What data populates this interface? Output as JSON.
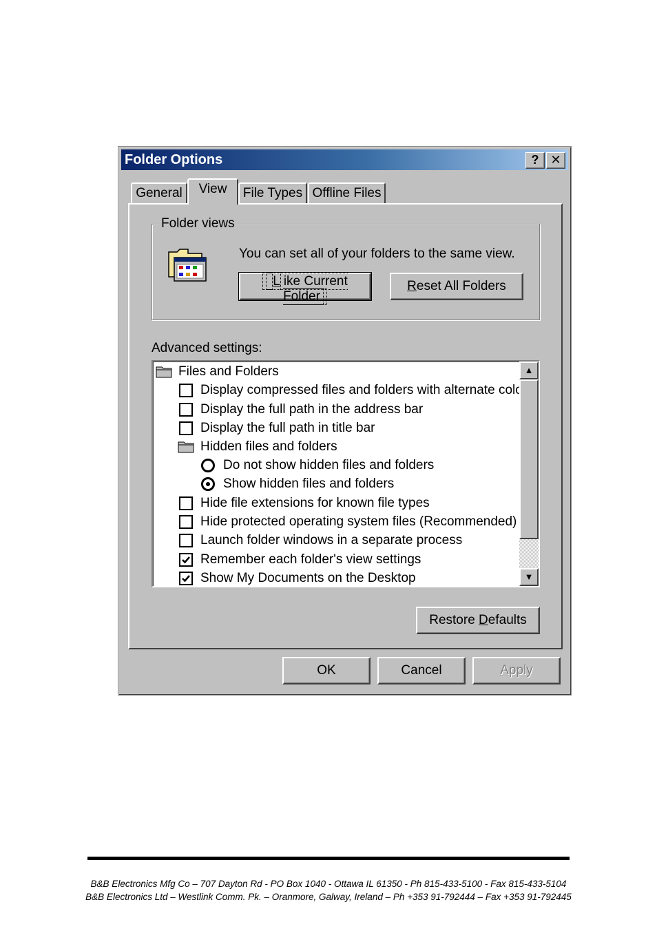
{
  "dialog": {
    "title": "Folder Options",
    "help_glyph": "?",
    "close_glyph": "✕",
    "tabs": [
      {
        "label": "General"
      },
      {
        "label": "View"
      },
      {
        "label": "File Types"
      },
      {
        "label": "Offline Files"
      }
    ],
    "active_tab": "View",
    "folder_views": {
      "label": "Folder views",
      "description": "You can set all of your folders to the same view.",
      "like_current_pre": "",
      "like_current_accel": "L",
      "like_current_post": "ike Current Folder",
      "reset_pre": "",
      "reset_accel": "R",
      "reset_post": "eset All Folders"
    },
    "advanced": {
      "label": "Advanced settings:",
      "items": [
        {
          "type": "folder",
          "label": "Files and Folders"
        },
        {
          "type": "checkbox",
          "checked": false,
          "label": "Display compressed files and folders with alternate color"
        },
        {
          "type": "checkbox",
          "checked": false,
          "label": "Display the full path in the address bar"
        },
        {
          "type": "checkbox",
          "checked": false,
          "label": "Display the full path in title bar"
        },
        {
          "type": "folder",
          "label": "Hidden files and folders"
        },
        {
          "type": "radio",
          "checked": false,
          "label": "Do not show hidden files and folders"
        },
        {
          "type": "radio",
          "checked": true,
          "label": "Show hidden files and folders"
        },
        {
          "type": "checkbox",
          "checked": false,
          "label": "Hide file extensions for known file types"
        },
        {
          "type": "checkbox",
          "checked": false,
          "label": "Hide protected operating system files (Recommended)"
        },
        {
          "type": "checkbox",
          "checked": false,
          "label": "Launch folder windows in a separate process"
        },
        {
          "type": "checkbox",
          "checked": true,
          "label": "Remember each folder's view settings"
        },
        {
          "type": "checkbox",
          "checked": true,
          "label": "Show My Documents on the Desktop"
        }
      ],
      "scroll_up_glyph": "▲",
      "scroll_down_glyph": "▼"
    },
    "restore_pre": "Restore ",
    "restore_accel": "D",
    "restore_post": "efaults",
    "ok_label": "OK",
    "cancel_label": "Cancel",
    "apply_pre": "",
    "apply_accel": "A",
    "apply_post": "pply"
  },
  "footer": {
    "line1": "B&B Electronics Mfg Co – 707 Dayton Rd - PO Box 1040 - Ottawa IL 61350 - Ph 815-433-5100 - Fax 815-433-5104",
    "line2": "B&B Electronics Ltd – Westlink Comm. Pk. – Oranmore, Galway, Ireland – Ph +353 91-792444 – Fax +353 91-792445"
  },
  "colors": {
    "face": "#c0c0c0",
    "title_start": "#0a246a",
    "title_end": "#a6caf0"
  }
}
